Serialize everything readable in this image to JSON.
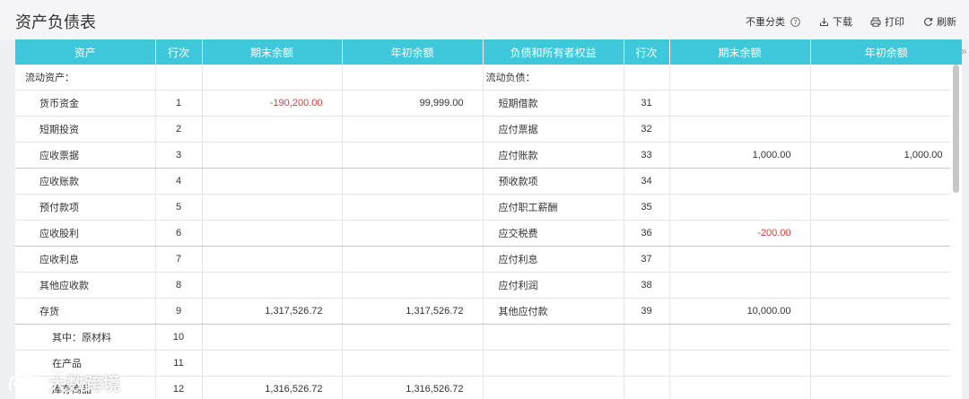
{
  "page": {
    "title": "资产负债表",
    "toolbar": {
      "no_split": "不重分类",
      "download": "下载",
      "print": "打印",
      "refresh": "刷新"
    }
  },
  "table": {
    "headers": [
      "资产",
      "行次",
      "期末余额",
      "年初余额",
      "负债和所有者权益",
      "行次",
      "期末余额",
      "年初余额"
    ],
    "rows": [
      {
        "a_name": "流动资产：",
        "a_line": "",
        "a_end": "",
        "a_begin": "",
        "l_name": "流动负债：",
        "l_line": "",
        "l_end": "",
        "l_begin": ""
      },
      {
        "a_name": "货币资金",
        "a_line": "1",
        "a_end": "-190,200.00",
        "a_begin": "99,999.00",
        "l_name": "短期借款",
        "l_line": "31",
        "l_end": "",
        "l_begin": ""
      },
      {
        "a_name": "短期投资",
        "a_line": "2",
        "a_end": "",
        "a_begin": "",
        "l_name": "应付票据",
        "l_line": "32",
        "l_end": "",
        "l_begin": ""
      },
      {
        "a_name": "应收票据",
        "a_line": "3",
        "a_end": "",
        "a_begin": "",
        "l_name": "应付账款",
        "l_line": "33",
        "l_end": "1,000.00",
        "l_begin": "1,000.00"
      },
      {
        "a_name": "应收账款",
        "a_line": "4",
        "a_end": "",
        "a_begin": "",
        "l_name": "预收款项",
        "l_line": "34",
        "l_end": "",
        "l_begin": ""
      },
      {
        "a_name": "预付款项",
        "a_line": "5",
        "a_end": "",
        "a_begin": "",
        "l_name": "应付职工薪酬",
        "l_line": "35",
        "l_end": "",
        "l_begin": ""
      },
      {
        "a_name": "应收股利",
        "a_line": "6",
        "a_end": "",
        "a_begin": "",
        "l_name": "应交税费",
        "l_line": "36",
        "l_end": "-200.00",
        "l_begin": ""
      },
      {
        "a_name": "应收利息",
        "a_line": "7",
        "a_end": "",
        "a_begin": "",
        "l_name": "应付利息",
        "l_line": "37",
        "l_end": "",
        "l_begin": ""
      },
      {
        "a_name": "其他应收款",
        "a_line": "8",
        "a_end": "",
        "a_begin": "",
        "l_name": "应付利润",
        "l_line": "38",
        "l_end": "",
        "l_begin": ""
      },
      {
        "a_name": "存货",
        "a_line": "9",
        "a_end": "1,317,526.72",
        "a_begin": "1,317,526.72",
        "l_name": "其他应付款",
        "l_line": "39",
        "l_end": "10,000.00",
        "l_begin": ""
      },
      {
        "a_name": "其中：原材料",
        "a_line": "10",
        "a_end": "",
        "a_begin": "",
        "l_name": "",
        "l_line": "",
        "l_end": "",
        "l_begin": ""
      },
      {
        "a_name": "在产品",
        "a_line": "11",
        "a_end": "",
        "a_begin": "",
        "l_name": "",
        "l_line": "",
        "l_end": "",
        "l_begin": ""
      },
      {
        "a_name": "库存商品",
        "a_line": "12",
        "a_end": "1,316,526.72",
        "a_begin": "1,316,526.72",
        "l_name": "",
        "l_line": "",
        "l_end": "",
        "l_begin": ""
      }
    ]
  },
  "watermark": {
    "text": "大数跨境",
    "icon": "bubble-logo-icon"
  },
  "colors": {
    "header_bg": "#3fc8dc",
    "negative": "#e23a3a",
    "page_bg": "#eef0f3"
  }
}
